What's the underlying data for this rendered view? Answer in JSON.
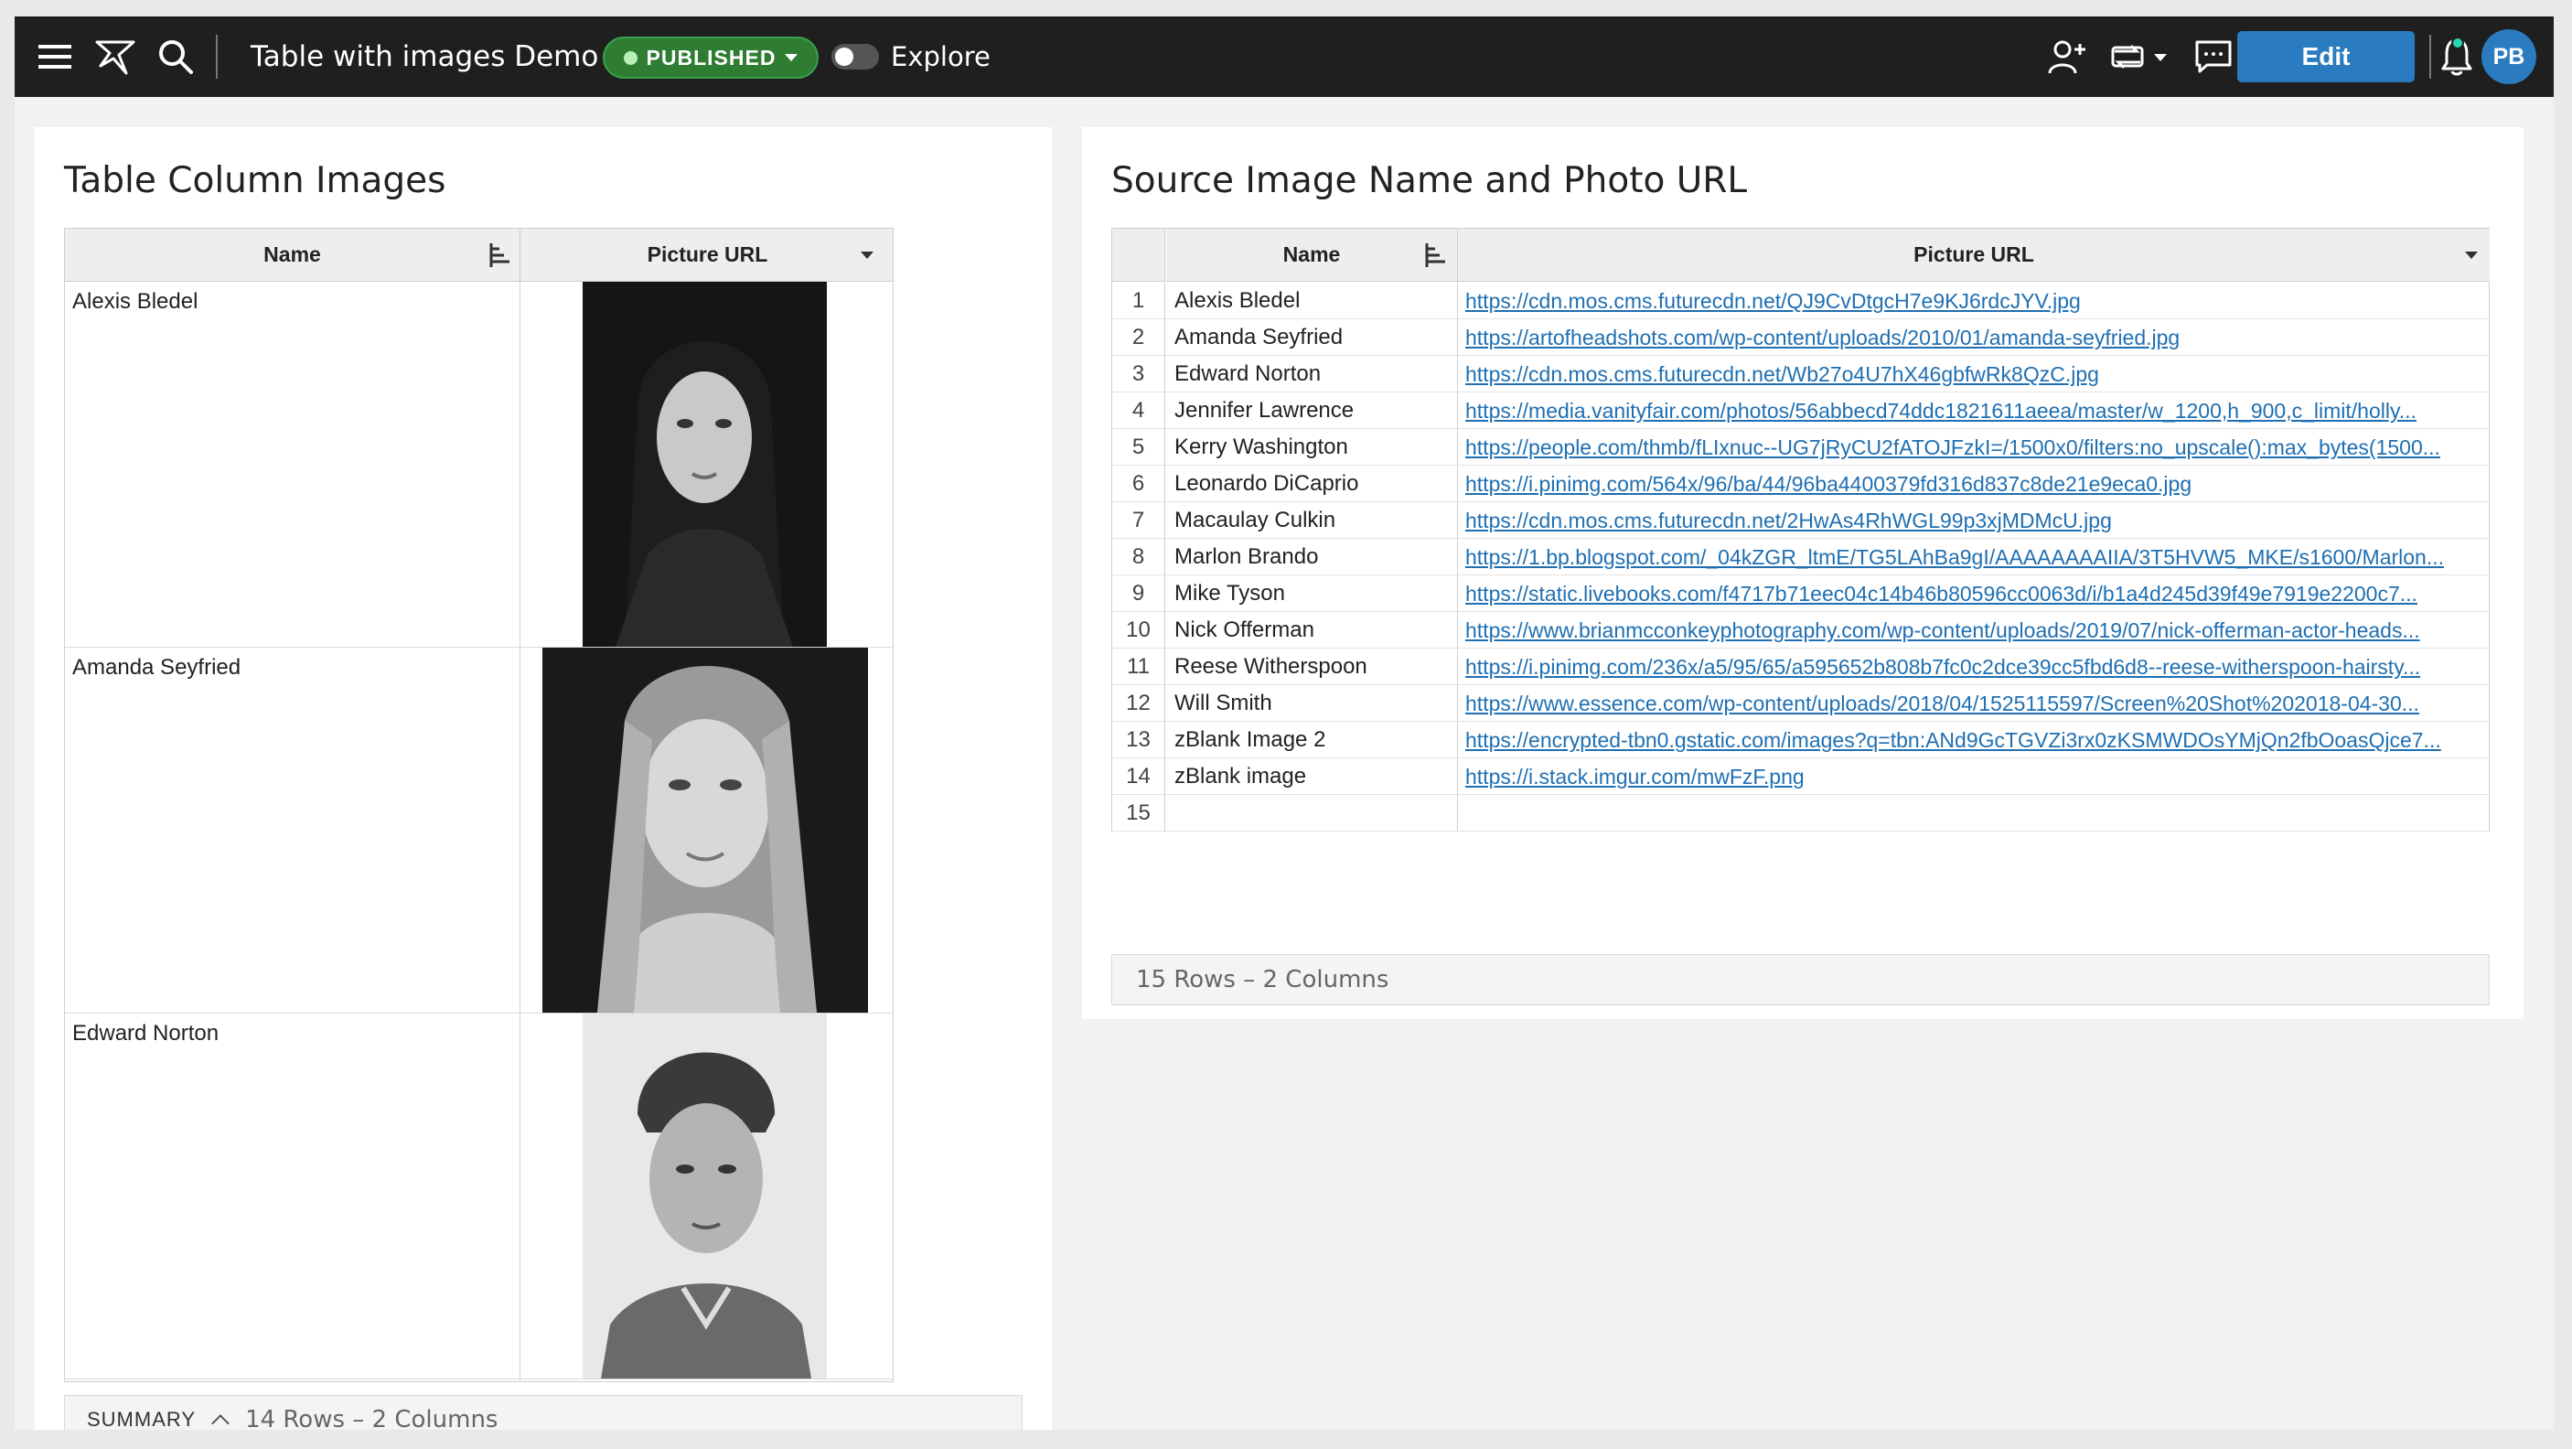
{
  "header": {
    "document_title": "Table with images Demo",
    "status_badge": "PUBLISHED",
    "explore_label": "Explore",
    "edit_label": "Edit",
    "avatar_initials": "PB"
  },
  "left_panel": {
    "title": "Table Column Images",
    "columns": [
      "Name",
      "Picture URL"
    ],
    "rows": [
      {
        "name": "Alexis Bledel"
      },
      {
        "name": "Amanda Seyfried"
      },
      {
        "name": "Edward Norton"
      }
    ],
    "summary_label": "SUMMARY",
    "row_count": "14 Rows – 2 Columns"
  },
  "right_panel": {
    "title": "Source Image Name and Photo URL",
    "columns": [
      "Name",
      "Picture URL"
    ],
    "rows": [
      {
        "num": "1",
        "name": "Alexis Bledel",
        "url": "https://cdn.mos.cms.futurecdn.net/QJ9CvDtgcH7e9KJ6rdcJYV.jpg"
      },
      {
        "num": "2",
        "name": "Amanda Seyfried",
        "url": "https://artofheadshots.com/wp-content/uploads/2010/01/amanda-seyfried.jpg"
      },
      {
        "num": "3",
        "name": "Edward Norton",
        "url": "https://cdn.mos.cms.futurecdn.net/Wb27o4U7hX46gbfwRk8QzC.jpg"
      },
      {
        "num": "4",
        "name": "Jennifer Lawrence",
        "url": "https://media.vanityfair.com/photos/56abbecd74ddc1821611aeea/master/w_1200,h_900,c_limit/holly..."
      },
      {
        "num": "5",
        "name": "Kerry Washington",
        "url": "https://people.com/thmb/fLIxnuc--UG7jRyCU2fATOJFzkI=/1500x0/filters:no_upscale():max_bytes(1500..."
      },
      {
        "num": "6",
        "name": "Leonardo DiCaprio",
        "url": "https://i.pinimg.com/564x/96/ba/44/96ba4400379fd316d837c8de21e9eca0.jpg"
      },
      {
        "num": "7",
        "name": "Macaulay Culkin",
        "url": "https://cdn.mos.cms.futurecdn.net/2HwAs4RhWGL99p3xjMDMcU.jpg"
      },
      {
        "num": "8",
        "name": "Marlon Brando",
        "url": "https://1.bp.blogspot.com/_04kZGR_ltmE/TG5LAhBa9gI/AAAAAAAAIIA/3T5HVW5_MKE/s1600/Marlon..."
      },
      {
        "num": "9",
        "name": "Mike Tyson",
        "url": "https://static.livebooks.com/f4717b71eec04c14b46b80596cc0063d/i/b1a4d245d39f49e7919e2200c7..."
      },
      {
        "num": "10",
        "name": "Nick Offerman",
        "url": "https://www.brianmcconkeyphotography.com/wp-content/uploads/2019/07/nick-offerman-actor-heads..."
      },
      {
        "num": "11",
        "name": "Reese Witherspoon",
        "url": "https://i.pinimg.com/236x/a5/95/65/a595652b808b7fc0c2dce39cc5fbd6d8--reese-witherspoon-hairsty..."
      },
      {
        "num": "12",
        "name": "Will Smith",
        "url": "https://www.essence.com/wp-content/uploads/2018/04/1525115597/Screen%20Shot%202018-04-30..."
      },
      {
        "num": "13",
        "name": "zBlank Image 2",
        "url": "https://encrypted-tbn0.gstatic.com/images?q=tbn:ANd9GcTGVZi3rx0zKSMWDOsYMjQn2fbOoasQjce7..."
      },
      {
        "num": "14",
        "name": "zBlank image",
        "url": "https://i.stack.imgur.com/mwFzF.png"
      },
      {
        "num": "15",
        "name": "",
        "url": ""
      }
    ],
    "row_count": "15 Rows – 2 Columns"
  },
  "colors": {
    "topbar_bg": "#1f1f1f",
    "accent_blue": "#2b7bc0",
    "published_green": "#2e7d32",
    "link_blue": "#1f6fb2"
  }
}
